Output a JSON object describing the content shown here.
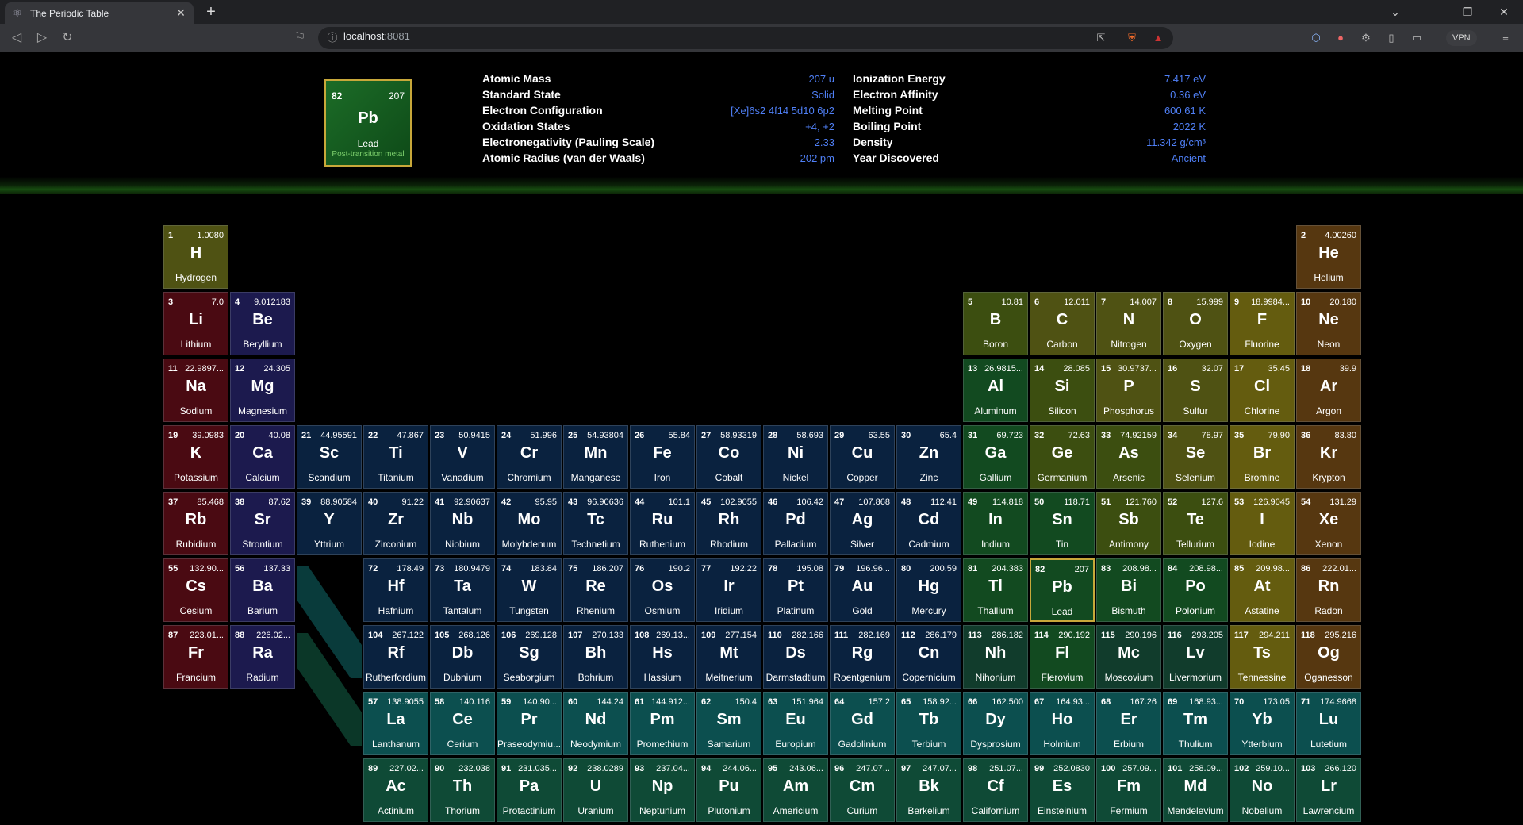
{
  "browser": {
    "tab_title": "The Periodic Table",
    "url_host": "localhost",
    "url_port": ":8081",
    "vpn_label": "VPN"
  },
  "colors": {
    "alkali": "#4a0a12",
    "alkaline": "#1c1a4e",
    "transition": "#0a223f",
    "post": "#124a20",
    "metalloid": "#3c4e10",
    "nonmetal": "#4f5213",
    "halogen": "#645c0f",
    "noble": "#563710",
    "lanth": "#0c4f4f",
    "actin": "#0f4a36",
    "value_text": "#4f7ff5",
    "selected_border": "#c8a83a"
  },
  "selected": {
    "number": "82",
    "mass": "207",
    "symbol": "Pb",
    "name": "Lead",
    "category": "Post-transition metal",
    "props_left": [
      {
        "label": "Atomic Mass",
        "value": "207 u"
      },
      {
        "label": "Standard State",
        "value": "Solid"
      },
      {
        "label": "Electron Configuration",
        "value": "[Xe]6s2 4f14 5d10 6p2"
      },
      {
        "label": "Oxidation States",
        "value": "+4, +2"
      },
      {
        "label": "Electronegativity (Pauling Scale)",
        "value": "2.33"
      },
      {
        "label": "Atomic Radius (van der Waals)",
        "value": "202 pm"
      }
    ],
    "props_right": [
      {
        "label": "Ionization Energy",
        "value": "7.417 eV"
      },
      {
        "label": "Electron Affinity",
        "value": "0.36 eV"
      },
      {
        "label": "Melting Point",
        "value": "600.61 K"
      },
      {
        "label": "Boiling Point",
        "value": "2022 K"
      },
      {
        "label": "Density",
        "value": "11.342 g/cm³"
      },
      {
        "label": "Year Discovered",
        "value": "Ancient"
      }
    ]
  },
  "elements": [
    {
      "n": "1",
      "m": "1.0080",
      "s": "H",
      "name": "Hydrogen",
      "c": "nonmetal",
      "r": 1,
      "g": 1
    },
    {
      "n": "2",
      "m": "4.00260",
      "s": "He",
      "name": "Helium",
      "c": "noble",
      "r": 1,
      "g": 18
    },
    {
      "n": "3",
      "m": "7.0",
      "s": "Li",
      "name": "Lithium",
      "c": "alkali",
      "r": 2,
      "g": 1
    },
    {
      "n": "4",
      "m": "9.012183",
      "s": "Be",
      "name": "Beryllium",
      "c": "alkaline",
      "r": 2,
      "g": 2
    },
    {
      "n": "5",
      "m": "10.81",
      "s": "B",
      "name": "Boron",
      "c": "metalloid",
      "r": 2,
      "g": 13
    },
    {
      "n": "6",
      "m": "12.011",
      "s": "C",
      "name": "Carbon",
      "c": "nonmetal",
      "r": 2,
      "g": 14
    },
    {
      "n": "7",
      "m": "14.007",
      "s": "N",
      "name": "Nitrogen",
      "c": "nonmetal",
      "r": 2,
      "g": 15
    },
    {
      "n": "8",
      "m": "15.999",
      "s": "O",
      "name": "Oxygen",
      "c": "nonmetal",
      "r": 2,
      "g": 16
    },
    {
      "n": "9",
      "m": "18.9984...",
      "s": "F",
      "name": "Fluorine",
      "c": "halogen",
      "r": 2,
      "g": 17
    },
    {
      "n": "10",
      "m": "20.180",
      "s": "Ne",
      "name": "Neon",
      "c": "noble",
      "r": 2,
      "g": 18
    },
    {
      "n": "11",
      "m": "22.9897...",
      "s": "Na",
      "name": "Sodium",
      "c": "alkali",
      "r": 3,
      "g": 1
    },
    {
      "n": "12",
      "m": "24.305",
      "s": "Mg",
      "name": "Magnesium",
      "c": "alkaline",
      "r": 3,
      "g": 2
    },
    {
      "n": "13",
      "m": "26.9815...",
      "s": "Al",
      "name": "Aluminum",
      "c": "post",
      "r": 3,
      "g": 13
    },
    {
      "n": "14",
      "m": "28.085",
      "s": "Si",
      "name": "Silicon",
      "c": "metalloid",
      "r": 3,
      "g": 14
    },
    {
      "n": "15",
      "m": "30.9737...",
      "s": "P",
      "name": "Phosphorus",
      "c": "nonmetal",
      "r": 3,
      "g": 15
    },
    {
      "n": "16",
      "m": "32.07",
      "s": "S",
      "name": "Sulfur",
      "c": "nonmetal",
      "r": 3,
      "g": 16
    },
    {
      "n": "17",
      "m": "35.45",
      "s": "Cl",
      "name": "Chlorine",
      "c": "halogen",
      "r": 3,
      "g": 17
    },
    {
      "n": "18",
      "m": "39.9",
      "s": "Ar",
      "name": "Argon",
      "c": "noble",
      "r": 3,
      "g": 18
    },
    {
      "n": "19",
      "m": "39.0983",
      "s": "K",
      "name": "Potassium",
      "c": "alkali",
      "r": 4,
      "g": 1
    },
    {
      "n": "20",
      "m": "40.08",
      "s": "Ca",
      "name": "Calcium",
      "c": "alkaline",
      "r": 4,
      "g": 2
    },
    {
      "n": "21",
      "m": "44.95591",
      "s": "Sc",
      "name": "Scandium",
      "c": "transition",
      "r": 4,
      "g": 3
    },
    {
      "n": "22",
      "m": "47.867",
      "s": "Ti",
      "name": "Titanium",
      "c": "transition",
      "r": 4,
      "g": 4
    },
    {
      "n": "23",
      "m": "50.9415",
      "s": "V",
      "name": "Vanadium",
      "c": "transition",
      "r": 4,
      "g": 5
    },
    {
      "n": "24",
      "m": "51.996",
      "s": "Cr",
      "name": "Chromium",
      "c": "transition",
      "r": 4,
      "g": 6
    },
    {
      "n": "25",
      "m": "54.93804",
      "s": "Mn",
      "name": "Manganese",
      "c": "transition",
      "r": 4,
      "g": 7
    },
    {
      "n": "26",
      "m": "55.84",
      "s": "Fe",
      "name": "Iron",
      "c": "transition",
      "r": 4,
      "g": 8
    },
    {
      "n": "27",
      "m": "58.93319",
      "s": "Co",
      "name": "Cobalt",
      "c": "transition",
      "r": 4,
      "g": 9
    },
    {
      "n": "28",
      "m": "58.693",
      "s": "Ni",
      "name": "Nickel",
      "c": "transition",
      "r": 4,
      "g": 10
    },
    {
      "n": "29",
      "m": "63.55",
      "s": "Cu",
      "name": "Copper",
      "c": "transition",
      "r": 4,
      "g": 11
    },
    {
      "n": "30",
      "m": "65.4",
      "s": "Zn",
      "name": "Zinc",
      "c": "transition",
      "r": 4,
      "g": 12
    },
    {
      "n": "31",
      "m": "69.723",
      "s": "Ga",
      "name": "Gallium",
      "c": "post",
      "r": 4,
      "g": 13
    },
    {
      "n": "32",
      "m": "72.63",
      "s": "Ge",
      "name": "Germanium",
      "c": "metalloid",
      "r": 4,
      "g": 14
    },
    {
      "n": "33",
      "m": "74.92159",
      "s": "As",
      "name": "Arsenic",
      "c": "metalloid",
      "r": 4,
      "g": 15
    },
    {
      "n": "34",
      "m": "78.97",
      "s": "Se",
      "name": "Selenium",
      "c": "nonmetal",
      "r": 4,
      "g": 16
    },
    {
      "n": "35",
      "m": "79.90",
      "s": "Br",
      "name": "Bromine",
      "c": "halogen",
      "r": 4,
      "g": 17
    },
    {
      "n": "36",
      "m": "83.80",
      "s": "Kr",
      "name": "Krypton",
      "c": "noble",
      "r": 4,
      "g": 18
    },
    {
      "n": "37",
      "m": "85.468",
      "s": "Rb",
      "name": "Rubidium",
      "c": "alkali",
      "r": 5,
      "g": 1
    },
    {
      "n": "38",
      "m": "87.62",
      "s": "Sr",
      "name": "Strontium",
      "c": "alkaline",
      "r": 5,
      "g": 2
    },
    {
      "n": "39",
      "m": "88.90584",
      "s": "Y",
      "name": "Yttrium",
      "c": "transition",
      "r": 5,
      "g": 3
    },
    {
      "n": "40",
      "m": "91.22",
      "s": "Zr",
      "name": "Zirconium",
      "c": "transition",
      "r": 5,
      "g": 4
    },
    {
      "n": "41",
      "m": "92.90637",
      "s": "Nb",
      "name": "Niobium",
      "c": "transition",
      "r": 5,
      "g": 5
    },
    {
      "n": "42",
      "m": "95.95",
      "s": "Mo",
      "name": "Molybdenum",
      "c": "transition",
      "r": 5,
      "g": 6
    },
    {
      "n": "43",
      "m": "96.90636",
      "s": "Tc",
      "name": "Technetium",
      "c": "transition",
      "r": 5,
      "g": 7
    },
    {
      "n": "44",
      "m": "101.1",
      "s": "Ru",
      "name": "Ruthenium",
      "c": "transition",
      "r": 5,
      "g": 8
    },
    {
      "n": "45",
      "m": "102.9055",
      "s": "Rh",
      "name": "Rhodium",
      "c": "transition",
      "r": 5,
      "g": 9
    },
    {
      "n": "46",
      "m": "106.42",
      "s": "Pd",
      "name": "Palladium",
      "c": "transition",
      "r": 5,
      "g": 10
    },
    {
      "n": "47",
      "m": "107.868",
      "s": "Ag",
      "name": "Silver",
      "c": "transition",
      "r": 5,
      "g": 11
    },
    {
      "n": "48",
      "m": "112.41",
      "s": "Cd",
      "name": "Cadmium",
      "c": "transition",
      "r": 5,
      "g": 12
    },
    {
      "n": "49",
      "m": "114.818",
      "s": "In",
      "name": "Indium",
      "c": "post",
      "r": 5,
      "g": 13
    },
    {
      "n": "50",
      "m": "118.71",
      "s": "Sn",
      "name": "Tin",
      "c": "post",
      "r": 5,
      "g": 14
    },
    {
      "n": "51",
      "m": "121.760",
      "s": "Sb",
      "name": "Antimony",
      "c": "metalloid",
      "r": 5,
      "g": 15
    },
    {
      "n": "52",
      "m": "127.6",
      "s": "Te",
      "name": "Tellurium",
      "c": "metalloid",
      "r": 5,
      "g": 16
    },
    {
      "n": "53",
      "m": "126.9045",
      "s": "I",
      "name": "Iodine",
      "c": "halogen",
      "r": 5,
      "g": 17
    },
    {
      "n": "54",
      "m": "131.29",
      "s": "Xe",
      "name": "Xenon",
      "c": "noble",
      "r": 5,
      "g": 18
    },
    {
      "n": "55",
      "m": "132.90...",
      "s": "Cs",
      "name": "Cesium",
      "c": "alkali",
      "r": 6,
      "g": 1
    },
    {
      "n": "56",
      "m": "137.33",
      "s": "Ba",
      "name": "Barium",
      "c": "alkaline",
      "r": 6,
      "g": 2
    },
    {
      "n": "72",
      "m": "178.49",
      "s": "Hf",
      "name": "Hafnium",
      "c": "transition",
      "r": 6,
      "g": 4
    },
    {
      "n": "73",
      "m": "180.9479",
      "s": "Ta",
      "name": "Tantalum",
      "c": "transition",
      "r": 6,
      "g": 5
    },
    {
      "n": "74",
      "m": "183.84",
      "s": "W",
      "name": "Tungsten",
      "c": "transition",
      "r": 6,
      "g": 6
    },
    {
      "n": "75",
      "m": "186.207",
      "s": "Re",
      "name": "Rhenium",
      "c": "transition",
      "r": 6,
      "g": 7
    },
    {
      "n": "76",
      "m": "190.2",
      "s": "Os",
      "name": "Osmium",
      "c": "transition",
      "r": 6,
      "g": 8
    },
    {
      "n": "77",
      "m": "192.22",
      "s": "Ir",
      "name": "Iridium",
      "c": "transition",
      "r": 6,
      "g": 9
    },
    {
      "n": "78",
      "m": "195.08",
      "s": "Pt",
      "name": "Platinum",
      "c": "transition",
      "r": 6,
      "g": 10
    },
    {
      "n": "79",
      "m": "196.96...",
      "s": "Au",
      "name": "Gold",
      "c": "transition",
      "r": 6,
      "g": 11
    },
    {
      "n": "80",
      "m": "200.59",
      "s": "Hg",
      "name": "Mercury",
      "c": "transition",
      "r": 6,
      "g": 12
    },
    {
      "n": "81",
      "m": "204.383",
      "s": "Tl",
      "name": "Thallium",
      "c": "post",
      "r": 6,
      "g": 13
    },
    {
      "n": "82",
      "m": "207",
      "s": "Pb",
      "name": "Lead",
      "c": "post",
      "r": 6,
      "g": 14
    },
    {
      "n": "83",
      "m": "208.98...",
      "s": "Bi",
      "name": "Bismuth",
      "c": "post",
      "r": 6,
      "g": 15
    },
    {
      "n": "84",
      "m": "208.98...",
      "s": "Po",
      "name": "Polonium",
      "c": "post",
      "r": 6,
      "g": 16
    },
    {
      "n": "85",
      "m": "209.98...",
      "s": "At",
      "name": "Astatine",
      "c": "halogen",
      "r": 6,
      "g": 17
    },
    {
      "n": "86",
      "m": "222.01...",
      "s": "Rn",
      "name": "Radon",
      "c": "noble",
      "r": 6,
      "g": 18
    },
    {
      "n": "87",
      "m": "223.01...",
      "s": "Fr",
      "name": "Francium",
      "c": "alkali",
      "r": 7,
      "g": 1
    },
    {
      "n": "88",
      "m": "226.02...",
      "s": "Ra",
      "name": "Radium",
      "c": "alkaline",
      "r": 7,
      "g": 2
    },
    {
      "n": "104",
      "m": "267.122",
      "s": "Rf",
      "name": "Rutherfordium",
      "c": "transition",
      "r": 7,
      "g": 4
    },
    {
      "n": "105",
      "m": "268.126",
      "s": "Db",
      "name": "Dubnium",
      "c": "transition",
      "r": 7,
      "g": 5
    },
    {
      "n": "106",
      "m": "269.128",
      "s": "Sg",
      "name": "Seaborgium",
      "c": "transition",
      "r": 7,
      "g": 6
    },
    {
      "n": "107",
      "m": "270.133",
      "s": "Bh",
      "name": "Bohrium",
      "c": "transition",
      "r": 7,
      "g": 7
    },
    {
      "n": "108",
      "m": "269.13...",
      "s": "Hs",
      "name": "Hassium",
      "c": "transition",
      "r": 7,
      "g": 8
    },
    {
      "n": "109",
      "m": "277.154",
      "s": "Mt",
      "name": "Meitnerium",
      "c": "transition",
      "r": 7,
      "g": 9
    },
    {
      "n": "110",
      "m": "282.166",
      "s": "Ds",
      "name": "Darmstadtium",
      "c": "transition",
      "r": 7,
      "g": 10
    },
    {
      "n": "111",
      "m": "282.169",
      "s": "Rg",
      "name": "Roentgenium",
      "c": "transition",
      "r": 7,
      "g": 11
    },
    {
      "n": "112",
      "m": "286.179",
      "s": "Cn",
      "name": "Copernicium",
      "c": "transition",
      "r": 7,
      "g": 12
    },
    {
      "n": "113",
      "m": "286.182",
      "s": "Nh",
      "name": "Nihonium",
      "c": "unknown",
      "r": 7,
      "g": 13
    },
    {
      "n": "114",
      "m": "290.192",
      "s": "Fl",
      "name": "Flerovium",
      "c": "post",
      "r": 7,
      "g": 14
    },
    {
      "n": "115",
      "m": "290.196",
      "s": "Mc",
      "name": "Moscovium",
      "c": "unknown",
      "r": 7,
      "g": 15
    },
    {
      "n": "116",
      "m": "293.205",
      "s": "Lv",
      "name": "Livermorium",
      "c": "unknown",
      "r": 7,
      "g": 16
    },
    {
      "n": "117",
      "m": "294.211",
      "s": "Ts",
      "name": "Tennessine",
      "c": "halogen",
      "r": 7,
      "g": 17
    },
    {
      "n": "118",
      "m": "295.216",
      "s": "Og",
      "name": "Oganesson",
      "c": "noble",
      "r": 7,
      "g": 18
    },
    {
      "n": "57",
      "m": "138.9055",
      "s": "La",
      "name": "Lanthanum",
      "c": "lanth",
      "r": 8,
      "g": 4
    },
    {
      "n": "58",
      "m": "140.116",
      "s": "Ce",
      "name": "Cerium",
      "c": "lanth",
      "r": 8,
      "g": 5
    },
    {
      "n": "59",
      "m": "140.90...",
      "s": "Pr",
      "name": "Praseodymiu...",
      "c": "lanth",
      "r": 8,
      "g": 6
    },
    {
      "n": "60",
      "m": "144.24",
      "s": "Nd",
      "name": "Neodymium",
      "c": "lanth",
      "r": 8,
      "g": 7
    },
    {
      "n": "61",
      "m": "144.912...",
      "s": "Pm",
      "name": "Promethium",
      "c": "lanth",
      "r": 8,
      "g": 8
    },
    {
      "n": "62",
      "m": "150.4",
      "s": "Sm",
      "name": "Samarium",
      "c": "lanth",
      "r": 8,
      "g": 9
    },
    {
      "n": "63",
      "m": "151.964",
      "s": "Eu",
      "name": "Europium",
      "c": "lanth",
      "r": 8,
      "g": 10
    },
    {
      "n": "64",
      "m": "157.2",
      "s": "Gd",
      "name": "Gadolinium",
      "c": "lanth",
      "r": 8,
      "g": 11
    },
    {
      "n": "65",
      "m": "158.92...",
      "s": "Tb",
      "name": "Terbium",
      "c": "lanth",
      "r": 8,
      "g": 12
    },
    {
      "n": "66",
      "m": "162.500",
      "s": "Dy",
      "name": "Dysprosium",
      "c": "lanth",
      "r": 8,
      "g": 13
    },
    {
      "n": "67",
      "m": "164.93...",
      "s": "Ho",
      "name": "Holmium",
      "c": "lanth",
      "r": 8,
      "g": 14
    },
    {
      "n": "68",
      "m": "167.26",
      "s": "Er",
      "name": "Erbium",
      "c": "lanth",
      "r": 8,
      "g": 15
    },
    {
      "n": "69",
      "m": "168.93...",
      "s": "Tm",
      "name": "Thulium",
      "c": "lanth",
      "r": 8,
      "g": 16
    },
    {
      "n": "70",
      "m": "173.05",
      "s": "Yb",
      "name": "Ytterbium",
      "c": "lanth",
      "r": 8,
      "g": 17
    },
    {
      "n": "71",
      "m": "174.9668",
      "s": "Lu",
      "name": "Lutetium",
      "c": "lanth",
      "r": 8,
      "g": 18
    },
    {
      "n": "89",
      "m": "227.02...",
      "s": "Ac",
      "name": "Actinium",
      "c": "actin",
      "r": 9,
      "g": 4
    },
    {
      "n": "90",
      "m": "232.038",
      "s": "Th",
      "name": "Thorium",
      "c": "actin",
      "r": 9,
      "g": 5
    },
    {
      "n": "91",
      "m": "231.035...",
      "s": "Pa",
      "name": "Protactinium",
      "c": "actin",
      "r": 9,
      "g": 6
    },
    {
      "n": "92",
      "m": "238.0289",
      "s": "U",
      "name": "Uranium",
      "c": "actin",
      "r": 9,
      "g": 7
    },
    {
      "n": "93",
      "m": "237.04...",
      "s": "Np",
      "name": "Neptunium",
      "c": "actin",
      "r": 9,
      "g": 8
    },
    {
      "n": "94",
      "m": "244.06...",
      "s": "Pu",
      "name": "Plutonium",
      "c": "actin",
      "r": 9,
      "g": 9
    },
    {
      "n": "95",
      "m": "243.06...",
      "s": "Am",
      "name": "Americium",
      "c": "actin",
      "r": 9,
      "g": 10
    },
    {
      "n": "96",
      "m": "247.07...",
      "s": "Cm",
      "name": "Curium",
      "c": "actin",
      "r": 9,
      "g": 11
    },
    {
      "n": "97",
      "m": "247.07...",
      "s": "Bk",
      "name": "Berkelium",
      "c": "actin",
      "r": 9,
      "g": 12
    },
    {
      "n": "98",
      "m": "251.07...",
      "s": "Cf",
      "name": "Californium",
      "c": "actin",
      "r": 9,
      "g": 13
    },
    {
      "n": "99",
      "m": "252.0830",
      "s": "Es",
      "name": "Einsteinium",
      "c": "actin",
      "r": 9,
      "g": 14
    },
    {
      "n": "100",
      "m": "257.09...",
      "s": "Fm",
      "name": "Fermium",
      "c": "actin",
      "r": 9,
      "g": 15
    },
    {
      "n": "101",
      "m": "258.09...",
      "s": "Md",
      "name": "Mendelevium",
      "c": "actin",
      "r": 9,
      "g": 16
    },
    {
      "n": "102",
      "m": "259.10...",
      "s": "No",
      "name": "Nobelium",
      "c": "actin",
      "r": 9,
      "g": 17
    },
    {
      "n": "103",
      "m": "266.120",
      "s": "Lr",
      "name": "Lawrencium",
      "c": "actin",
      "r": 9,
      "g": 18
    }
  ]
}
